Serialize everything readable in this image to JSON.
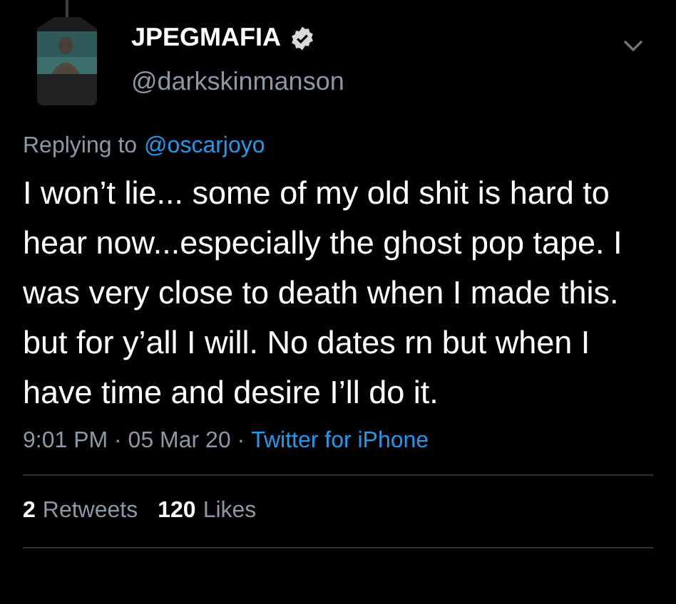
{
  "tweet": {
    "author": {
      "name": "JPEGMAFIA",
      "verified": true,
      "handle": "@darkskinmanson"
    },
    "reply_to": {
      "prefix": "Replying to",
      "handle": "@oscarjoyo"
    },
    "text": "I won’t lie... some of my old shit is hard to hear now...especially the ghost pop tape. I was very close to death when I made this. but for y’all I will. No dates rn but when I have time and desire I’ll do it.",
    "timestamp": "9:01 PM · 05 Mar 20 · ",
    "source": "Twitter for iPhone",
    "stats": [
      {
        "count": "2",
        "label": "Retweets"
      },
      {
        "count": "120",
        "label": "Likes"
      }
    ]
  }
}
